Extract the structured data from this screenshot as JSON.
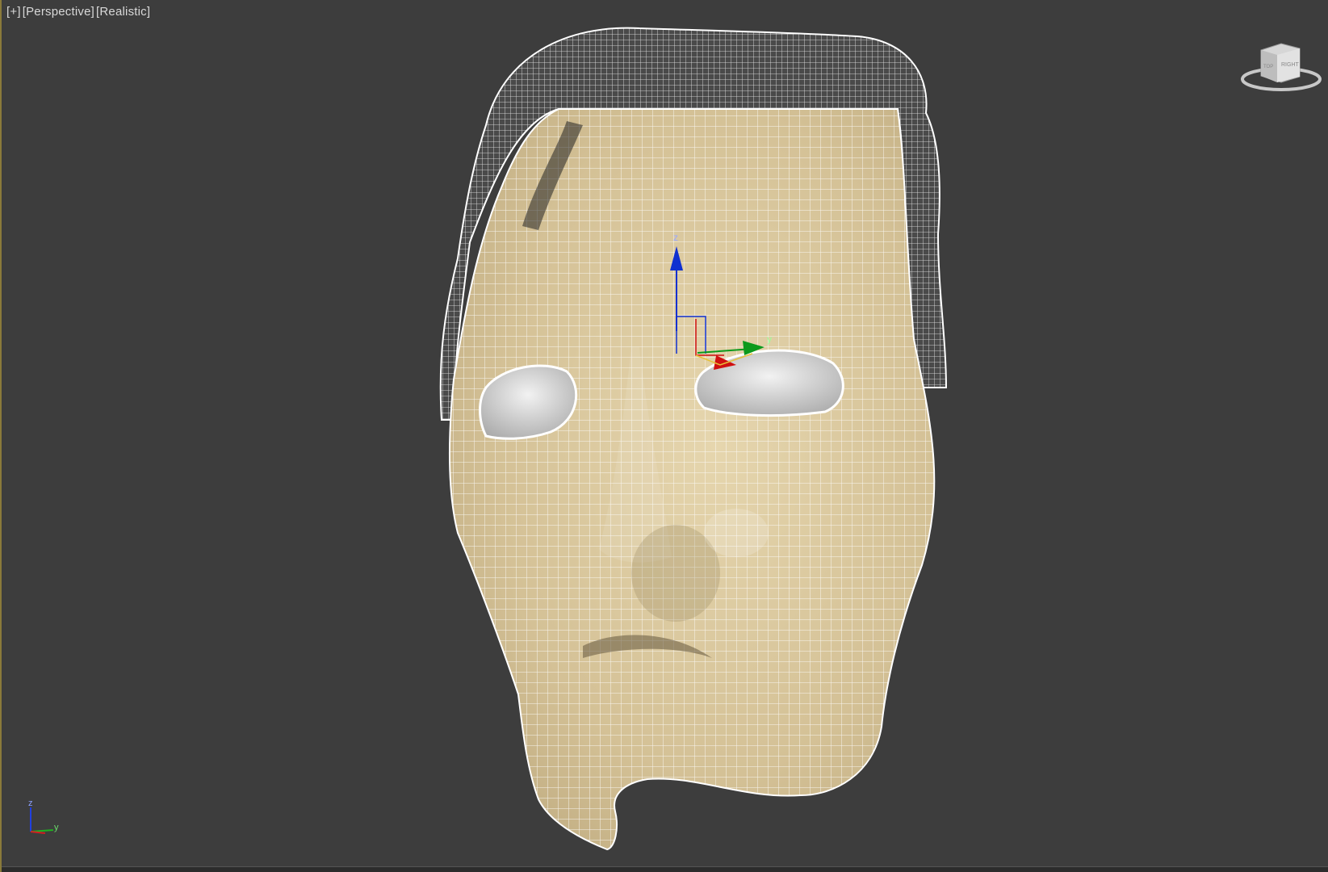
{
  "viewport": {
    "labels": [
      "[+]",
      "[Perspective]",
      "[Realistic]"
    ],
    "background_color": "#3d3d3d",
    "active_border_color": "#8a7a3a"
  },
  "viewcube": {
    "face_left": "TOP",
    "face_right": "RIGHT"
  },
  "gizmo": {
    "z_label": "z",
    "y_label": "y",
    "x_color": "#d01010",
    "y_color": "#0c9a1c",
    "z_color": "#1030d0"
  },
  "axis_tripod": {
    "z_label": "z",
    "y_label": "y"
  },
  "model": {
    "skin_color": "#d9c79c",
    "wire_color": "#ffffff"
  }
}
